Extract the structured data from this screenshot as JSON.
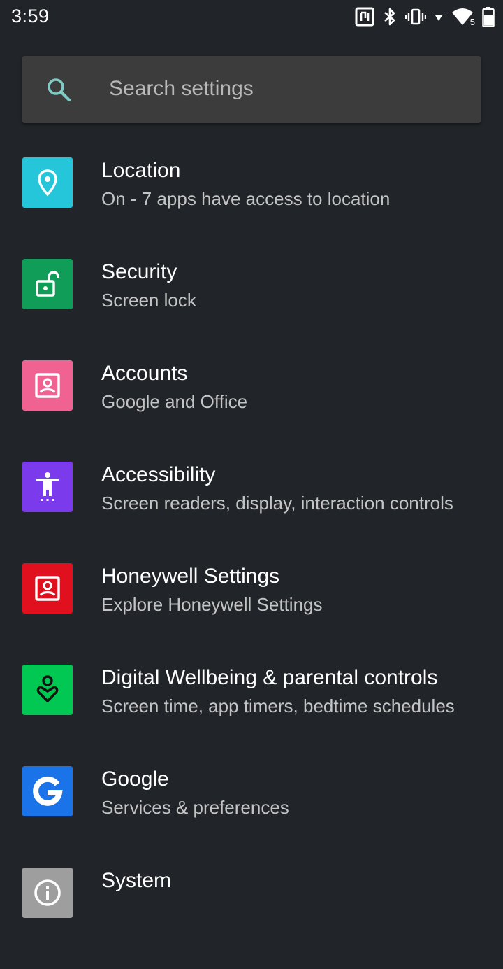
{
  "status_bar": {
    "time": "3:59",
    "icons": [
      "nfc-icon",
      "bluetooth-icon",
      "vibrate-icon",
      "data-arrows-icon",
      "wifi-icon",
      "battery-icon"
    ],
    "wifi_badge": "5"
  },
  "search": {
    "placeholder": "Search settings"
  },
  "settings": {
    "items": [
      {
        "title": "Location",
        "summary": "On - 7 apps have access to location",
        "icon": "location-pin-icon",
        "color": "#26c6da"
      },
      {
        "title": "Security",
        "summary": "Screen lock",
        "icon": "lock-open-icon",
        "color": "#0f9d58"
      },
      {
        "title": "Accounts",
        "summary": "Google and Office",
        "icon": "account-box-icon",
        "color": "#f06292"
      },
      {
        "title": "Accessibility",
        "summary": "Screen readers, display, interaction controls",
        "icon": "accessibility-icon",
        "color": "#7c3aed"
      },
      {
        "title": "Honeywell Settings",
        "summary": "Explore Honeywell Settings",
        "icon": "account-box-icon",
        "color": "#e0101e"
      },
      {
        "title": "Digital Wellbeing & parental controls",
        "summary": "Screen time, app timers, bedtime schedules",
        "icon": "wellbeing-icon",
        "color": "#00c853"
      },
      {
        "title": "Google",
        "summary": "Services & preferences",
        "icon": "google-g-icon",
        "color": "#1a73e8"
      },
      {
        "title": "System",
        "summary": "",
        "icon": "info-icon",
        "color": "#9e9e9e"
      }
    ]
  }
}
